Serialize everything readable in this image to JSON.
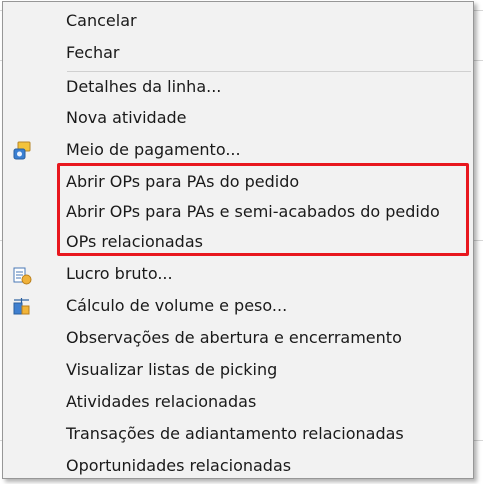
{
  "menu": {
    "items": [
      {
        "label": "Cancelar",
        "icon": null
      },
      {
        "label": "Fechar",
        "icon": null
      },
      {
        "label": "Detalhes da linha...",
        "icon": null
      },
      {
        "label": "Nova atividade",
        "icon": null
      },
      {
        "label": "Meio de pagamento...",
        "icon": "payment-icon"
      },
      {
        "label": "Abrir OPs para PAs do pedido",
        "icon": null
      },
      {
        "label": "Abrir OPs para PAs e semi-acabados do pedido",
        "icon": null
      },
      {
        "label": "OPs relacionadas",
        "icon": null
      },
      {
        "label": "Lucro bruto...",
        "icon": "gross-profit-icon"
      },
      {
        "label": "Cálculo de volume e peso...",
        "icon": "volume-weight-icon"
      },
      {
        "label": "Observações de abertura e encerramento",
        "icon": null
      },
      {
        "label": "Visualizar listas de picking",
        "icon": null
      },
      {
        "label": "Atividades relacionadas",
        "icon": null
      },
      {
        "label": "Transações de adiantamento relacionadas",
        "icon": null
      },
      {
        "label": "Oportunidades relacionadas",
        "icon": null
      }
    ]
  },
  "colors": {
    "menu_background": "#f2f2f2",
    "highlight_border": "#e8171e",
    "text": "#1a1a1a"
  }
}
